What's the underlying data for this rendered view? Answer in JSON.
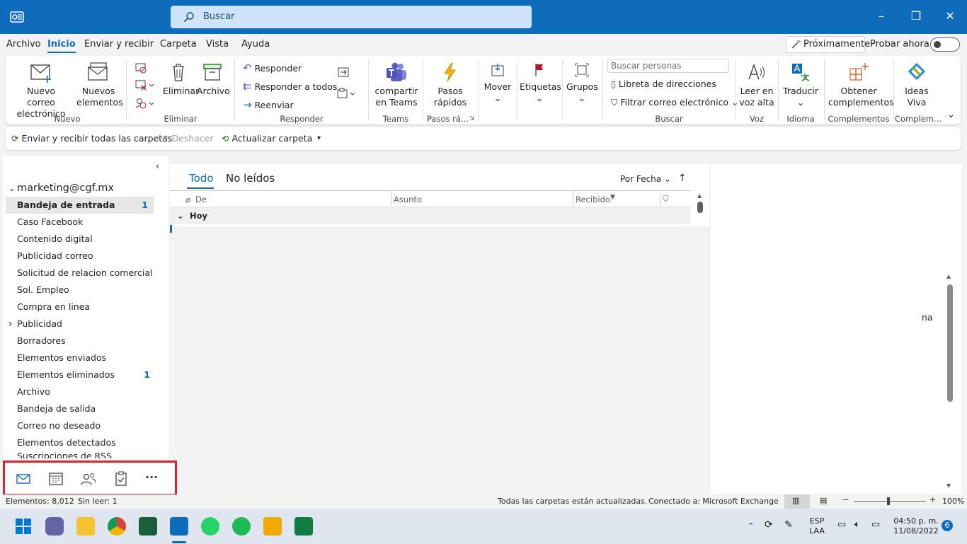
{
  "search": {
    "placeholder": "Buscar"
  },
  "menu": [
    "Archivo",
    "Inicio",
    "Enviar y recibir",
    "Carpeta",
    "Vista",
    "Ayuda"
  ],
  "menu_active": "Inicio",
  "top_right": {
    "proximamente": "Próximamente",
    "probar": "Probar ahora"
  },
  "ribbon": {
    "nuevo_correo": "Nuevo correo\nelectrónico",
    "nuevos_elementos": "Nuevos\nelementos",
    "eliminar": "Eliminar",
    "archivo": "Archivo",
    "responder": "Responder",
    "responder_todos": "Responder a todos",
    "reenviar": "Reenviar",
    "teams": "compartir\nen Teams",
    "pasos": "Pasos\nrápidos",
    "mover": "Mover",
    "etiquetas": "Etiquetas",
    "grupos": "Grupos",
    "buscar_personas": "Buscar personas",
    "libreta": "Libreta de direcciones",
    "filtrar": "Filtrar correo electrónico",
    "leer": "Leer en\nvoz alta",
    "traducir": "Traducir",
    "complementos": "Obtener\ncomplementos",
    "viva": "Ideas\nViva",
    "groups": [
      "Nuevo",
      "Eliminar",
      "Responder",
      "Teams",
      "Pasos rá...",
      "Buscar",
      "Voz",
      "Idioma",
      "Complementos",
      "Complem..."
    ]
  },
  "qat": {
    "enviar": "Enviar y recibir todas las carpetas",
    "deshacer": "Deshacer",
    "actualizar": "Actualizar carpeta"
  },
  "account": "marketing@cgf.mx",
  "folders": [
    {
      "name": "Bandeja de entrada",
      "count": "1"
    },
    {
      "name": "Caso Facebook",
      "count": ""
    },
    {
      "name": "Contenido digital",
      "count": ""
    },
    {
      "name": "Publicidad correo",
      "count": ""
    },
    {
      "name": "Solicitud de relacion comercial",
      "count": ""
    },
    {
      "name": "Sol. Empleo",
      "count": ""
    },
    {
      "name": "Compra en linea",
      "count": ""
    },
    {
      "name": "Publicidad",
      "count": ""
    },
    {
      "name": "Borradores",
      "count": ""
    },
    {
      "name": "Elementos enviados",
      "count": ""
    },
    {
      "name": "Elementos eliminados",
      "count": "1"
    },
    {
      "name": "Archivo",
      "count": ""
    },
    {
      "name": "Bandeja de salida",
      "count": ""
    },
    {
      "name": "Correo no deseado",
      "count": ""
    },
    {
      "name": "Elementos detectados",
      "count": ""
    },
    {
      "name": "Suscripciones de RSS",
      "count": ""
    }
  ],
  "list": {
    "tab_all": "Todo",
    "tab_unread": "No leídos",
    "sort": "Por Fecha",
    "col_from": "De",
    "col_subject": "Asunto",
    "col_received": "Recibido",
    "group_today": "Hoy"
  },
  "reading_fragment": "na",
  "status": {
    "items": "Elementos: 8,012",
    "unread": "Sin leer: 1",
    "updated": "Todas las carpetas están actualizadas.",
    "connected": "Conectado a: Microsoft Exchange",
    "zoom": "100%"
  },
  "tray": {
    "lang1": "ESP",
    "lang2": "LAA",
    "time": "04:50 p. m.",
    "date": "11/08/2022",
    "badge": "6"
  },
  "colors": {
    "accent": "#0f6cbd",
    "highlight": "#e0202b"
  }
}
